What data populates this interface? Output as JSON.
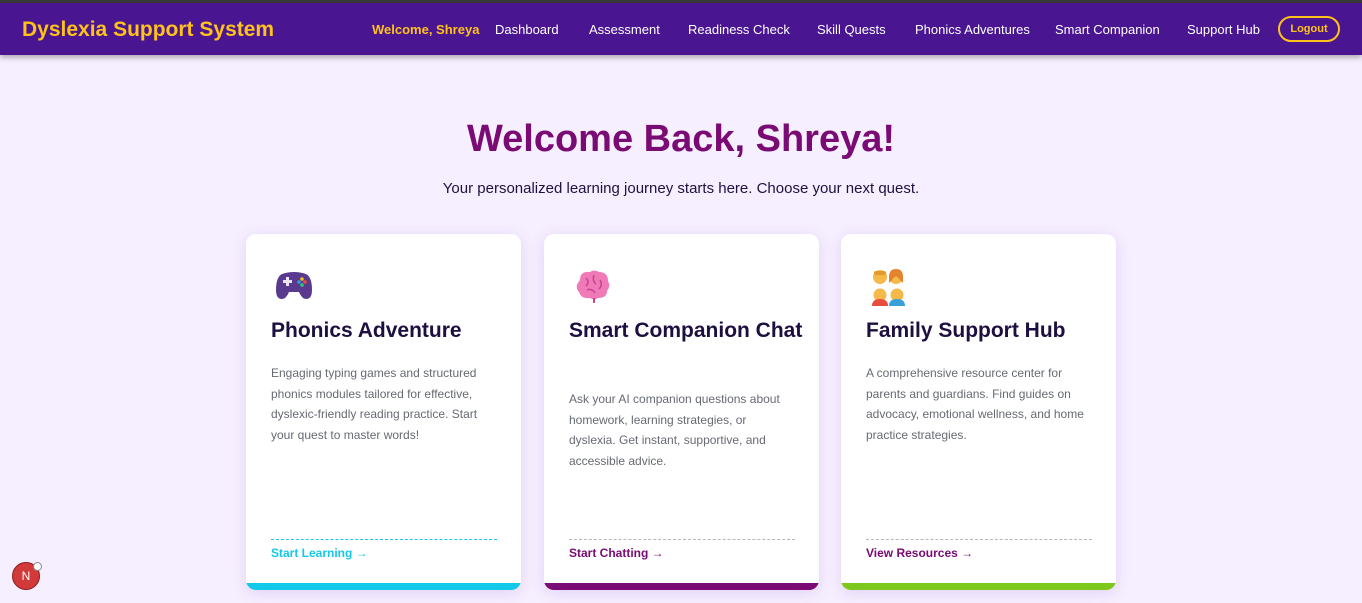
{
  "navbar": {
    "brand": "Dyslexia Support System",
    "welcome": "Welcome, Shreya",
    "links": [
      "Dashboard",
      "Assessment",
      "Readiness Check",
      "Skill Quests",
      "Phonics Adventures",
      "Smart Companion",
      "Support Hub"
    ],
    "logout": "Logout"
  },
  "hero": {
    "title": "Welcome Back, Shreya!",
    "subtitle": "Your personalized learning journey starts here. Choose your next quest."
  },
  "cards": [
    {
      "icon": "game-controller-icon",
      "title": "Phonics Adventure",
      "description": "Engaging typing games and structured phonics modules tailored for effective, dyslexic-friendly reading practice. Start your quest to master words!",
      "link": "Start Learning →",
      "accent": "#14c8ea"
    },
    {
      "icon": "brain-icon",
      "title": "Smart Companion Chat",
      "description": "Ask your AI companion questions about homework, learning strategies, or dyslexia. Get instant, supportive, and accessible advice.",
      "link": "Start Chatting →",
      "accent": "#7a0a74"
    },
    {
      "icon": "family-icon",
      "title": "Family Support Hub",
      "description": "A comprehensive resource center for parents and guardians. Find guides on advocacy, emotional wellness, and home practice strategies.",
      "link": "View Resources →",
      "accent": "#7cc81c"
    }
  ],
  "devtools_badge": "N"
}
